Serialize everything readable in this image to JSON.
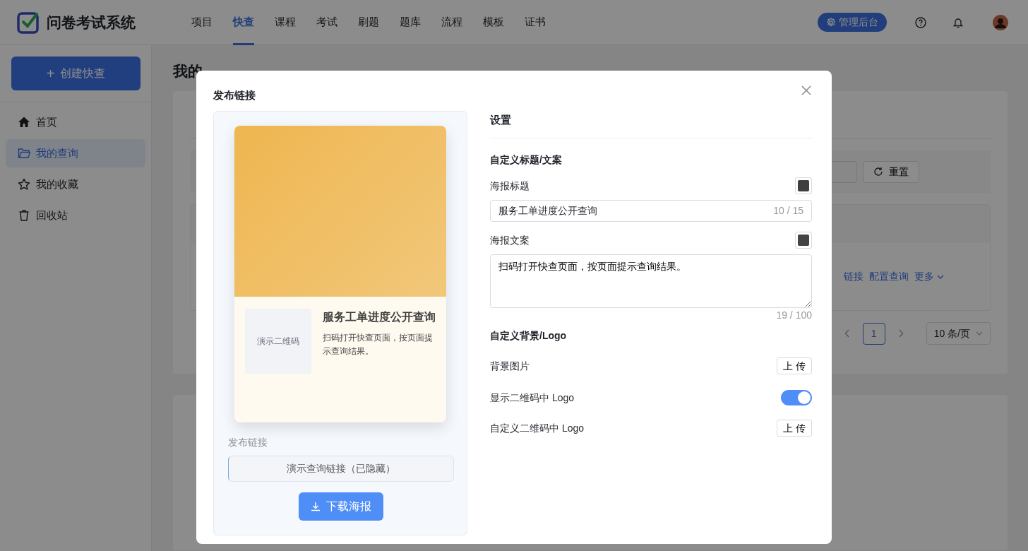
{
  "header": {
    "logo_text": "问卷考试系统",
    "nav": [
      {
        "label": "项目",
        "selected": false
      },
      {
        "label": "快查",
        "selected": true
      },
      {
        "label": "课程",
        "selected": false
      },
      {
        "label": "考试",
        "selected": false
      },
      {
        "label": "刷题",
        "selected": false
      },
      {
        "label": "题库",
        "selected": false
      },
      {
        "label": "流程",
        "selected": false
      },
      {
        "label": "模板",
        "selected": false
      },
      {
        "label": "证书",
        "selected": false
      }
    ],
    "admin_button": "管理后台"
  },
  "sidebar": {
    "create_button": "创建快查",
    "plus": "+",
    "items": [
      {
        "label": "首页",
        "selected": false
      },
      {
        "label": "我的查询",
        "selected": true
      },
      {
        "label": "我的收藏",
        "selected": false
      },
      {
        "label": "回收站",
        "selected": false
      }
    ]
  },
  "page": {
    "title": "我的",
    "reset_button": "重置",
    "row_actions": [
      "链接",
      "配置查询",
      "更多"
    ],
    "current_page": "1",
    "page_size": "10 条/页"
  },
  "modal": {
    "title": "发布链接",
    "poster": {
      "qr_placeholder": "演示二维码",
      "title": "服务工单进度公开查询",
      "description": "扫码打开快查页面，按页面提示查询结果。"
    },
    "link_label": "发布链接",
    "link_value": "演示查询链接（已隐藏）",
    "download_button": "下载海报",
    "settings": {
      "heading": "设置",
      "sections": [
        {
          "heading": "自定义标题/文案",
          "rows": [
            {
              "kind": "color",
              "label": "海报标题",
              "color": "#3f3f3f"
            },
            {
              "kind": "input",
              "value": "服务工单进度公开查询",
              "counter": "10 / 15"
            },
            {
              "kind": "color",
              "label": "海报文案",
              "color": "#444444"
            },
            {
              "kind": "textarea",
              "value": "扫码打开快查页面，按页面提示查询结果。",
              "counter": "19 / 100"
            }
          ]
        },
        {
          "heading": "自定义背景/Logo",
          "rows": [
            {
              "kind": "upload",
              "label": "背景图片",
              "button": "上 传"
            },
            {
              "kind": "switch",
              "label": "显示二维码中 Logo",
              "on": true
            },
            {
              "kind": "upload",
              "label": "自定义二维码中 Logo",
              "button": "上 传"
            }
          ]
        }
      ]
    }
  }
}
